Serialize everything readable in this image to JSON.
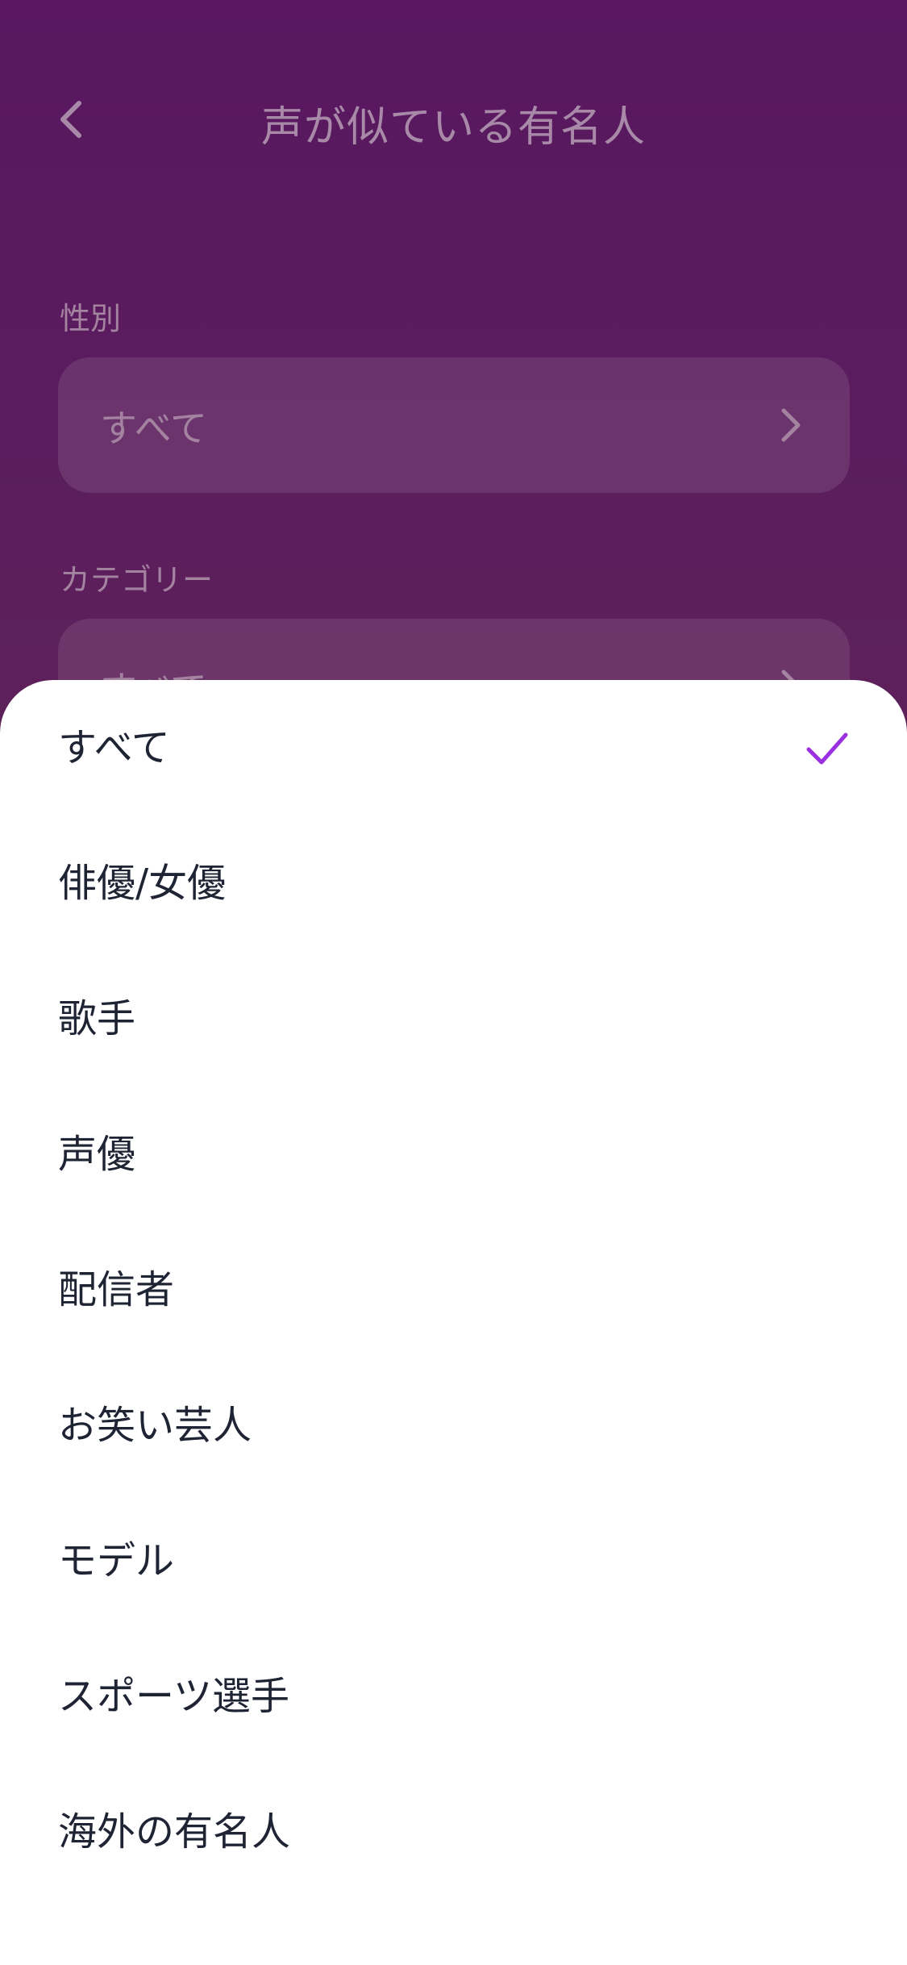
{
  "header": {
    "title": "声が似ている有名人",
    "back_icon": "chevron-left-icon"
  },
  "filters": {
    "gender": {
      "label": "性別",
      "value": "すべて"
    },
    "category": {
      "label": "カテゴリー",
      "value": "すべて"
    }
  },
  "sheet": {
    "selected_index": 0,
    "accent_color": "#9b30e0",
    "items": [
      {
        "label": "すべて",
        "selected": true
      },
      {
        "label": "俳優/女優",
        "selected": false
      },
      {
        "label": "歌手",
        "selected": false
      },
      {
        "label": "声優",
        "selected": false
      },
      {
        "label": "配信者",
        "selected": false
      },
      {
        "label": "お笑い芸人",
        "selected": false
      },
      {
        "label": "モデル",
        "selected": false
      },
      {
        "label": "スポーツ選手",
        "selected": false
      },
      {
        "label": "海外の有名人",
        "selected": false
      }
    ]
  }
}
